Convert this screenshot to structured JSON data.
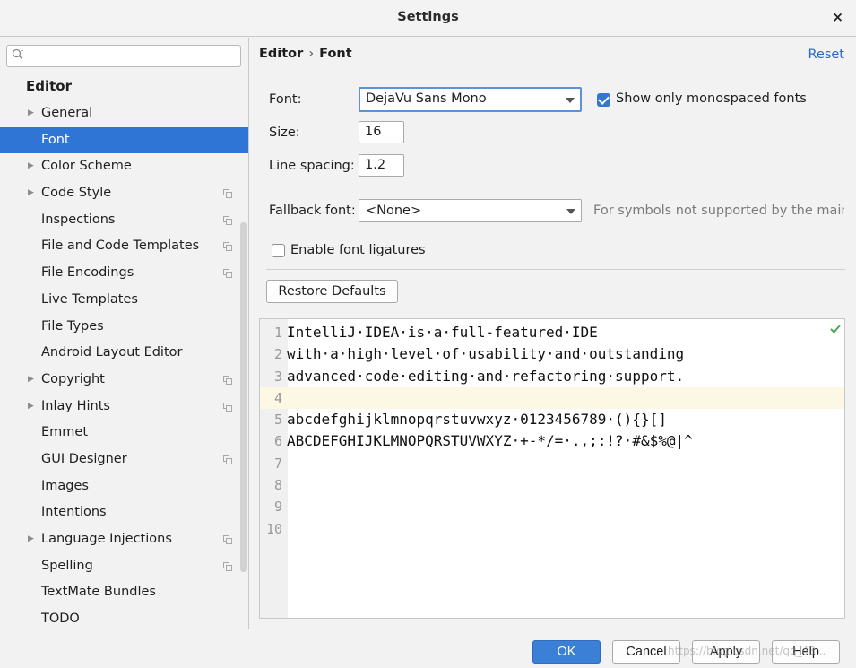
{
  "window": {
    "title": "Settings",
    "close_glyph": "×"
  },
  "colors": {
    "accent": "#2f75d5",
    "link": "#2a67c7",
    "primary_button": "#3b7fd6",
    "current_line": "#fcf8e3"
  },
  "search": {
    "value": "",
    "placeholder": ""
  },
  "sidebar": {
    "section": "Editor",
    "items": [
      {
        "label": "General",
        "expandable": true,
        "has_copy_icon": false
      },
      {
        "label": "Font",
        "expandable": false,
        "has_copy_icon": false,
        "selected": true
      },
      {
        "label": "Color Scheme",
        "expandable": true,
        "has_copy_icon": false
      },
      {
        "label": "Code Style",
        "expandable": true,
        "has_copy_icon": true
      },
      {
        "label": "Inspections",
        "expandable": false,
        "has_copy_icon": true
      },
      {
        "label": "File and Code Templates",
        "expandable": false,
        "has_copy_icon": true
      },
      {
        "label": "File Encodings",
        "expandable": false,
        "has_copy_icon": true
      },
      {
        "label": "Live Templates",
        "expandable": false,
        "has_copy_icon": false
      },
      {
        "label": "File Types",
        "expandable": false,
        "has_copy_icon": false
      },
      {
        "label": "Android Layout Editor",
        "expandable": false,
        "has_copy_icon": false
      },
      {
        "label": "Copyright",
        "expandable": true,
        "has_copy_icon": true
      },
      {
        "label": "Inlay Hints",
        "expandable": true,
        "has_copy_icon": true
      },
      {
        "label": "Emmet",
        "expandable": false,
        "has_copy_icon": false
      },
      {
        "label": "GUI Designer",
        "expandable": false,
        "has_copy_icon": true
      },
      {
        "label": "Images",
        "expandable": false,
        "has_copy_icon": false
      },
      {
        "label": "Intentions",
        "expandable": false,
        "has_copy_icon": false
      },
      {
        "label": "Language Injections",
        "expandable": true,
        "has_copy_icon": true
      },
      {
        "label": "Spelling",
        "expandable": false,
        "has_copy_icon": true
      },
      {
        "label": "TextMate Bundles",
        "expandable": false,
        "has_copy_icon": false
      },
      {
        "label": "TODO",
        "expandable": false,
        "has_copy_icon": false
      }
    ]
  },
  "header": {
    "crumb_parent": "Editor",
    "crumb_sep": "›",
    "crumb_current": "Font",
    "reset_label": "Reset"
  },
  "form": {
    "font_label": "Font:",
    "font_value": "DejaVu Sans Mono",
    "mono_only_label": "Show only monospaced fonts",
    "mono_only_checked": true,
    "size_label": "Size:",
    "size_value": "16",
    "spacing_label": "Line spacing:",
    "spacing_value": "1.2",
    "fallback_label": "Fallback font:",
    "fallback_value": "<None>",
    "fallback_hint": "For symbols not supported by the main f",
    "ligatures_label": "Enable font ligatures",
    "ligatures_checked": false,
    "restore_label": "Restore Defaults"
  },
  "preview": {
    "current_line": 4,
    "lines": [
      {
        "n": "1",
        "text": "IntelliJ·IDEA·is·a·full-featured·IDE"
      },
      {
        "n": "2",
        "text": "with·a·high·level·of·usability·and·outstanding"
      },
      {
        "n": "3",
        "text": "advanced·code·editing·and·refactoring·support."
      },
      {
        "n": "4",
        "text": ""
      },
      {
        "n": "5",
        "text": "abcdefghijklmnopqrstuvwxyz·0123456789·(){}[]"
      },
      {
        "n": "6",
        "text": "ABCDEFGHIJKLMNOPQRSTUVWXYZ·+-*/=·.,;:!?·#&$%@|^"
      },
      {
        "n": "7",
        "text": ""
      },
      {
        "n": "8",
        "text": ""
      },
      {
        "n": "9",
        "text": ""
      },
      {
        "n": "10",
        "text": ""
      }
    ]
  },
  "footer": {
    "ok_label": "OK",
    "cancel_label": "Cancel",
    "apply_label": "Apply",
    "help_label": "Help",
    "watermark": "https://blog.csdn.net/qq_43..."
  }
}
